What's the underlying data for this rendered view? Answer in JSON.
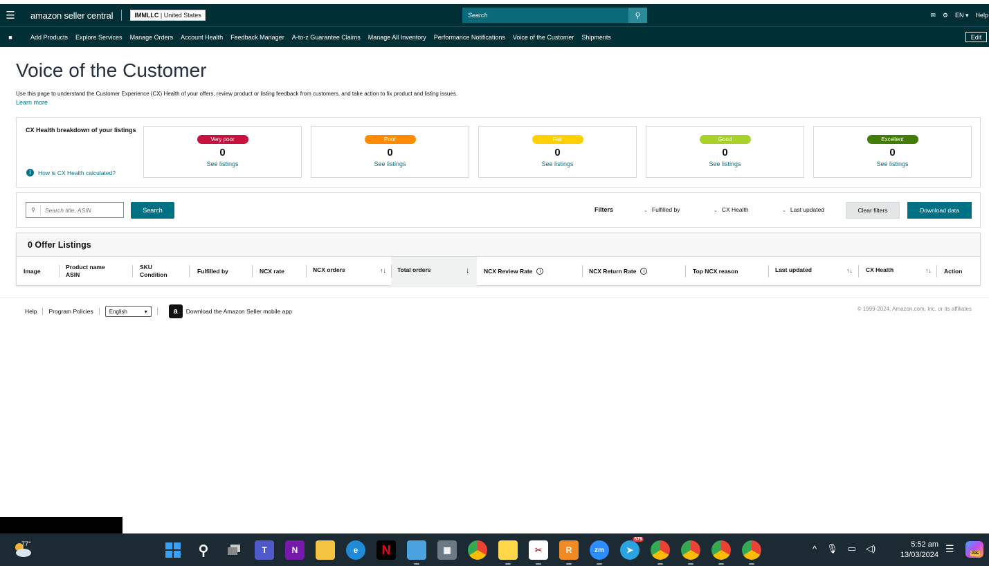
{
  "topbar": {
    "logo": "amazon seller central",
    "account_name": "IMMLLC",
    "account_region": "United States",
    "search_placeholder": "Search",
    "language": "EN",
    "help": "Help"
  },
  "nav": {
    "items": [
      "Add Products",
      "Explore Services",
      "Manage Orders",
      "Account Health",
      "Feedback Manager",
      "A-to-z Guarantee Claims",
      "Manage All Inventory",
      "Performance Notifications",
      "Voice of the Customer",
      "Shipments"
    ],
    "edit": "Edit"
  },
  "page": {
    "title": "Voice of the Customer",
    "description": "Use this page to understand the Customer Experience (CX) Health of your offers, review product or listing feedback from customers, and take action to fix product and listing issues.",
    "learn_more": "Learn more"
  },
  "health": {
    "title": "CX Health breakdown of your listings",
    "help_link": "How is CX Health calculated?",
    "boxes": [
      {
        "label": "Very poor",
        "count": "0",
        "link": "See listings",
        "color": "#c7113e"
      },
      {
        "label": "Poor",
        "count": "0",
        "link": "See listings",
        "color": "#ff8c00"
      },
      {
        "label": "Fair",
        "count": "0",
        "link": "See listings",
        "color": "#ffd000"
      },
      {
        "label": "Good",
        "count": "0",
        "link": "See listings",
        "color": "#a8d12a"
      },
      {
        "label": "Excellent",
        "count": "0",
        "link": "See listings",
        "color": "#437b07"
      }
    ]
  },
  "filters": {
    "search_placeholder": "Search title, ASIN",
    "search_button": "Search",
    "label": "Filters",
    "dropdowns": [
      "Fulfilled by",
      "CX Health",
      "Last updated"
    ],
    "clear": "Clear filters",
    "download": "Download data"
  },
  "table": {
    "heading": "0 Offer Listings",
    "columns": {
      "image": "Image",
      "product_name": "Product name",
      "asin": "ASIN",
      "sku": "SKU",
      "condition": "Condition",
      "fulfilled_by": "Fulfilled by",
      "ncx_rate": "NCX rate",
      "ncx_orders": "NCX orders",
      "total_orders": "Total orders",
      "ncx_review_rate": "NCX Review Rate",
      "ncx_return_rate": "NCX Return Rate",
      "top_ncx_reason": "Top NCX reason",
      "last_updated": "Last updated",
      "cx_health": "CX Health",
      "action": "Action"
    }
  },
  "footer": {
    "help": "Help",
    "policies": "Program Policies",
    "language": "English",
    "app": "Download the Amazon Seller mobile app",
    "copyright": "© 1999-2024, Amazon.com, Inc. or its affiliates"
  },
  "taskbar": {
    "temperature": "77°",
    "telegram_badge": "579",
    "time": "5:52 am",
    "date": "13/03/2024"
  }
}
